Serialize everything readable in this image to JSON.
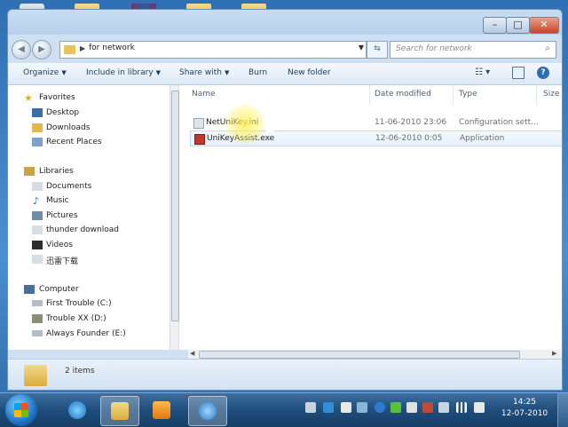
{
  "window": {
    "address": {
      "path": "for network"
    },
    "search": {
      "placeholder": "Search for network"
    },
    "controls": {
      "minimize": "–",
      "maximize": "□",
      "close": "✕"
    }
  },
  "toolbar": {
    "organize": "Organize",
    "include": "Include in library",
    "share": "Share with",
    "burn": "Burn",
    "new_folder": "New folder"
  },
  "nav": {
    "favorites": {
      "label": "Favorites",
      "items": [
        "Desktop",
        "Downloads",
        "Recent Places"
      ]
    },
    "libraries": {
      "label": "Libraries",
      "items": [
        "Documents",
        "Music",
        "Pictures",
        "thunder download",
        "Videos",
        "迅雷下载"
      ]
    },
    "computer": {
      "label": "Computer",
      "items": [
        "First Trouble (C:)",
        "Trouble XX (D:)",
        "Always Founder (E:)"
      ]
    }
  },
  "columns": {
    "name": "Name",
    "date": "Date modified",
    "type": "Type",
    "size": "Size"
  },
  "files": [
    {
      "name": "NetUniKey.ini",
      "date": "11-06-2010 23:06",
      "type": "Configuration sett...",
      "icon": "settings-file-icon"
    },
    {
      "name": "UniKeyAssist.exe",
      "date": "12-06-2010 0:05",
      "type": "Application",
      "icon": "application-icon"
    }
  ],
  "details": {
    "count": "2 items"
  },
  "taskbar": {
    "time": "14:25",
    "date": "12-07-2010"
  },
  "colors": {
    "accent": "#2f6db0",
    "selection": "#e6f0fc",
    "highlight": "#fff050"
  }
}
